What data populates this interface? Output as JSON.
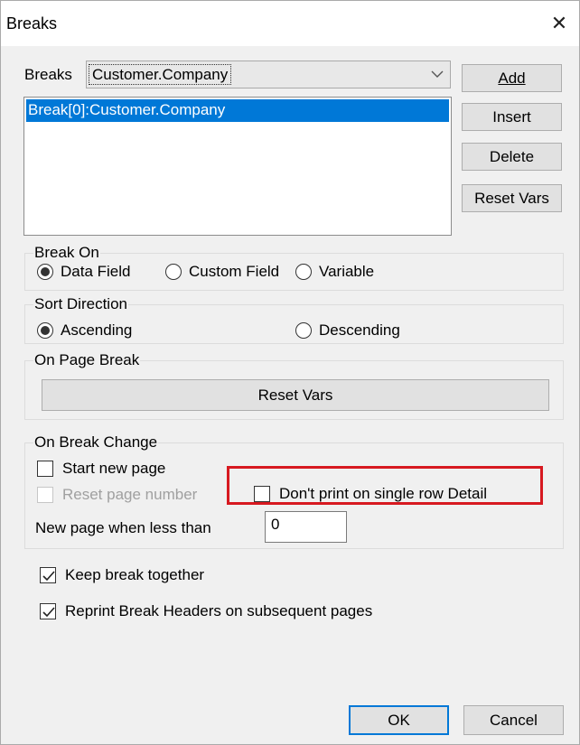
{
  "window": {
    "title": "Breaks",
    "close_glyph": "✕"
  },
  "breaks": {
    "label": "Breaks",
    "selected_value": "Customer.Company",
    "dropdown_glyph": "⌵",
    "list_items": [
      "Break[0]:Customer.Company"
    ]
  },
  "side_buttons": {
    "add": "Add",
    "insert": "Insert",
    "delete": "Delete",
    "reset_vars": "Reset Vars"
  },
  "break_on": {
    "legend": "Break On",
    "options": [
      {
        "label": "Data Field",
        "checked": true
      },
      {
        "label": "Custom Field",
        "checked": false
      },
      {
        "label": "Variable",
        "checked": false
      }
    ]
  },
  "sort_direction": {
    "legend": "Sort Direction",
    "options": [
      {
        "label": "Ascending",
        "checked": true
      },
      {
        "label": "Descending",
        "checked": false
      }
    ]
  },
  "on_page_break": {
    "legend": "On Page Break",
    "reset_vars_button": "Reset Vars"
  },
  "on_break_change": {
    "legend": "On Break Change",
    "start_new_page": {
      "label": "Start new page",
      "checked": false
    },
    "reset_page_number": {
      "label": "Reset page number",
      "checked": false,
      "disabled": true
    },
    "dont_print_single_row": {
      "label": "Don't print on single row Detail",
      "checked": false
    },
    "new_page_when_less_than": {
      "label": "New page when less than",
      "value": "0"
    }
  },
  "keep_break_together": {
    "label": "Keep break together",
    "checked": true
  },
  "reprint_break_headers": {
    "label": "Reprint Break Headers on subsequent pages",
    "checked": true
  },
  "footer": {
    "ok": "OK",
    "cancel": "Cancel"
  },
  "colors": {
    "selection": "#0078d7",
    "highlight_box": "#d71920",
    "dialog_bg": "#f0f0f0"
  }
}
